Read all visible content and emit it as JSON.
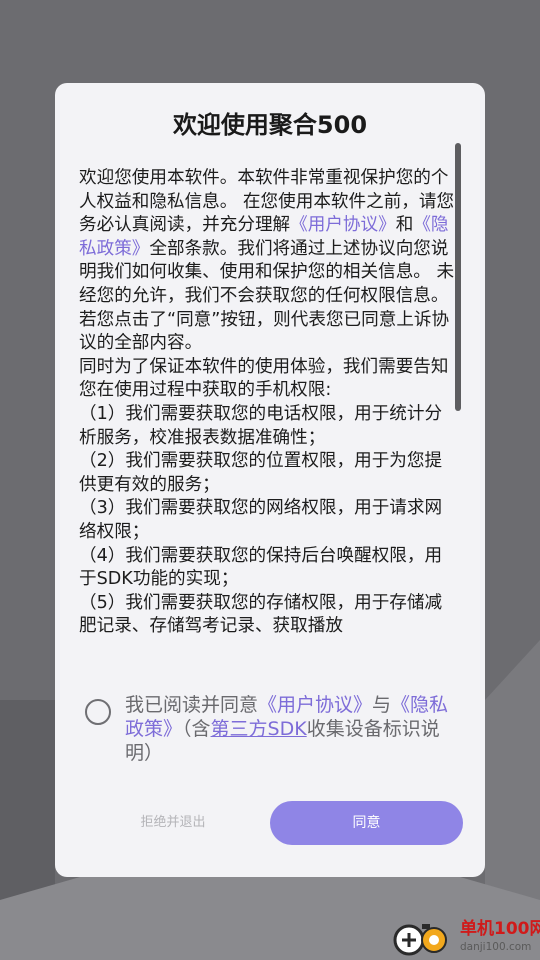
{
  "dialog": {
    "title": "欢迎使用聚合500",
    "body": {
      "p1_a": "欢迎您使用本软件。本软件非常重视保护您的个人权益和隐私信息。 在您使用本软件之前，请您务必认真阅读，并充分理解",
      "p1_link1": "《用户协议》",
      "p1_and": "和",
      "p1_link2": "《隐私政策》",
      "p1_b": "全部条款。我们将通过上述协议向您说明我们如何收集、使用和保护您的相关信息。 未经您的允许，我们不会获取您的任何权限信息。若您点击了“同意”按钮，则代表您已同意上诉协议的全部内容。",
      "p2": " 同时为了保证本软件的使用体验，我们需要告知您在使用过程中获取的手机权限:",
      "items": [
        "（1）我们需要获取您的电话权限，用于统计分析服务，校准报表数据准确性；",
        "（2）我们需要获取您的位置权限，用于为您提供更有效的服务；",
        "（3）我们需要获取您的网络权限，用于请求网络权限；",
        "（4）我们需要获取您的保持后台唤醒权限，用于SDK功能的实现；",
        "（5）我们需要获取您的存储权限，用于存储减肥记录、存储驾考记录、获取播放"
      ]
    },
    "consent": {
      "prefix": "我已阅读并同意",
      "link1": "《用户协议》",
      "and": "与",
      "link2": "《隐私政策》",
      "mid": "（含",
      "link3": "第三方SDK",
      "suffix": "收集设备标识说明）"
    },
    "buttons": {
      "reject": "拒绝并退出",
      "agree": "同意"
    }
  },
  "watermark": {
    "name": "单机100网",
    "url": "danji100.com"
  },
  "colors": {
    "accent": "#8f85e6",
    "link": "#7d6cd8",
    "watermark_red": "#d01a1a"
  }
}
